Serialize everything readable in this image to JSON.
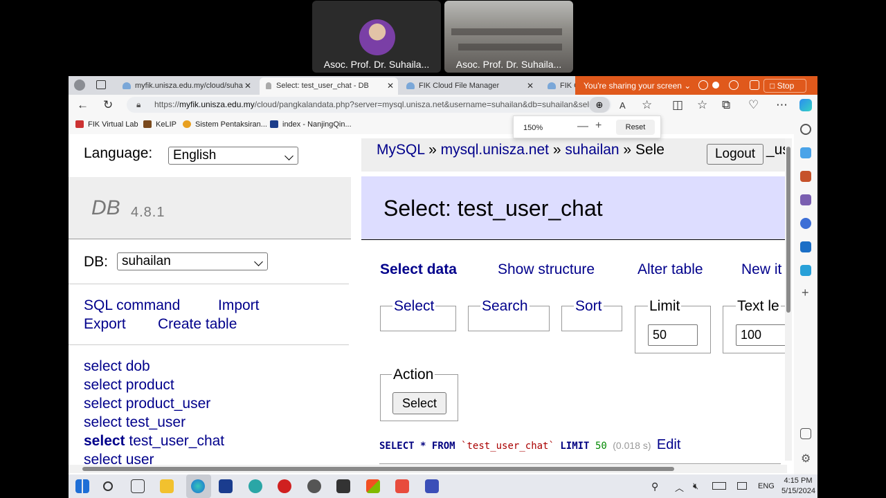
{
  "meeting": {
    "participants": [
      {
        "name": "Asoc. Prof. Dr. Suhaila..."
      },
      {
        "name": "Asoc. Prof. Dr. Suhaila..."
      }
    ]
  },
  "browser": {
    "tabs": [
      {
        "title": "myfik.unisza.edu.my/cloud/suha",
        "active": false
      },
      {
        "title": "Select: test_user_chat - DB",
        "active": true
      },
      {
        "title": "FIK Cloud File Manager",
        "active": false
      },
      {
        "title": "FIK C",
        "active": false
      }
    ],
    "sharing": {
      "text": "You're sharing your screen",
      "stop_label": "Stop"
    },
    "url_prefix": "https://",
    "url_host": "myfik.unisza.edu.my",
    "url_path": "/cloud/pangkalandata.php?server=mysql.unisza.net&username=suhailan&db=suhailan&sel...",
    "bookmarks": [
      "FIK Virtual Lab",
      "KeLIP",
      "Sistem Pentaksiran...",
      "index - NanjingQin..."
    ],
    "zoom": {
      "value": "150%",
      "reset_label": "Reset"
    }
  },
  "page": {
    "language_label": "Language:",
    "language_value": "English",
    "db_logo": "DB",
    "db_version": "4.8.1",
    "db_label": "DB:",
    "db_value": "suhailan",
    "links": {
      "sql_command": "SQL command",
      "import": "Import",
      "export": "Export",
      "create_table": "Create table"
    },
    "tables": [
      {
        "prefix": "select",
        "name": "dob",
        "active": false
      },
      {
        "prefix": "select",
        "name": "product",
        "active": false
      },
      {
        "prefix": "select",
        "name": "product_user",
        "active": false
      },
      {
        "prefix": "select",
        "name": "test_user",
        "active": false
      },
      {
        "prefix": "select",
        "name": "test_user_chat",
        "active": true
      },
      {
        "prefix": "select",
        "name": "user",
        "active": false
      }
    ],
    "breadcrumb": {
      "driver": "MySQL",
      "server": "mysql.unisza.net",
      "db": "suhailan",
      "current": "Sele",
      "tail": "_us"
    },
    "logout_label": "Logout",
    "title": "Select: test_user_chat",
    "menu": {
      "select_data": "Select data",
      "show_structure": "Show structure",
      "alter_table": "Alter table",
      "new_item": "New it"
    },
    "fieldsets": {
      "select": "Select",
      "search": "Search",
      "sort": "Sort",
      "limit": "Limit",
      "limit_value": "50",
      "text_length": "Text le",
      "text_length_value": "100",
      "action": "Action",
      "action_button": "Select"
    },
    "query": {
      "select": "SELECT",
      "star": "*",
      "from": "FROM",
      "table": "`test_user_chat`",
      "limit": "LIMIT",
      "limit_value": "50",
      "time": "(0.018 s)",
      "edit": "Edit"
    }
  },
  "taskbar": {
    "lang": "ENG",
    "time": "4:15 PM",
    "date": "5/15/2024"
  },
  "colors": {
    "share_bar": "#e0591c",
    "link": "#00008b",
    "heading_bg": "#ddddff"
  }
}
